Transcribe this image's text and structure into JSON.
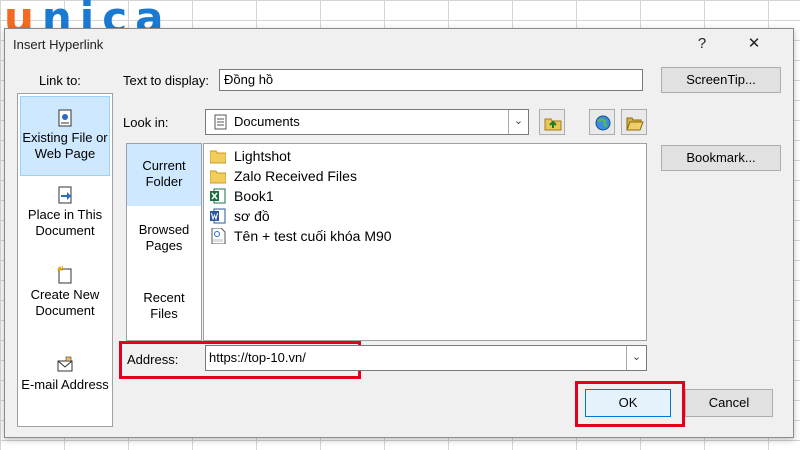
{
  "brand": {
    "logo_u": "u",
    "logo_rest": "nica"
  },
  "dialog": {
    "title": "Insert Hyperlink",
    "help": "?",
    "close": "✕",
    "link_to_label": "Link to:",
    "text_to_display_label": "Text to display:",
    "text_to_display_value": "Đồng hồ",
    "screentip": "ScreenTip...",
    "look_in_label": "Look in:",
    "look_in_value": "Documents",
    "bookmark": "Bookmark...",
    "address_label": "Address:",
    "address_value": "https://top-10.vn/",
    "ok": "OK",
    "cancel": "Cancel"
  },
  "link_to": [
    {
      "line1": "Existing File or",
      "line2": "Web Page",
      "selected": true
    },
    {
      "line1": "Place in This",
      "line2": "Document"
    },
    {
      "line1": "Create New",
      "line2": "Document"
    },
    {
      "line1": "E-mail Address",
      "line2": ""
    }
  ],
  "nav": [
    {
      "line1": "Current",
      "line2": "Folder",
      "selected": true
    },
    {
      "line1": "Browsed",
      "line2": "Pages"
    },
    {
      "line1": "Recent",
      "line2": "Files"
    }
  ],
  "files": [
    {
      "name": "Lightshot",
      "icon": "folder-icon"
    },
    {
      "name": "Zalo Received Files",
      "icon": "folder-icon"
    },
    {
      "name": "Book1",
      "icon": "excel-file-icon"
    },
    {
      "name": "sơ đồ",
      "icon": "word-file-icon"
    },
    {
      "name": "Tên + test cuối khóa M90",
      "icon": "pdf-file-icon"
    }
  ],
  "colors": {
    "highlight": "#e3001b",
    "selection": "#cde8ff",
    "brand_blue": "#1a7ad1",
    "brand_orange": "#f26b21"
  }
}
